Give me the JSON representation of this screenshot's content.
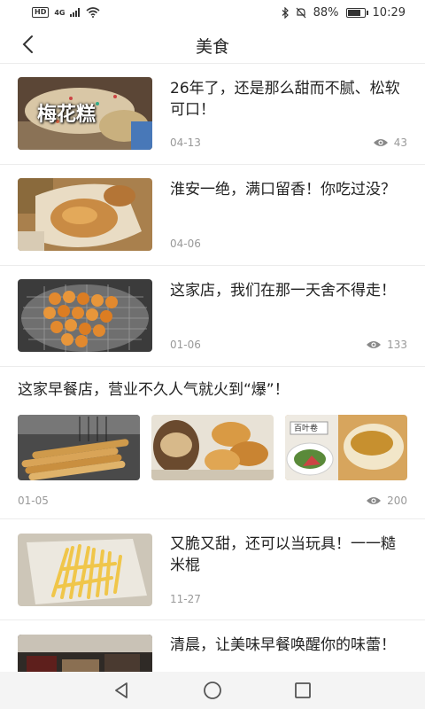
{
  "status": {
    "hd": "HD",
    "network": "4G",
    "battery": "88%",
    "battery_level": 0.88,
    "time": "10:29"
  },
  "header": {
    "title": "美食"
  },
  "articles": [
    {
      "title": "26年了，还是那么甜而不腻、松软可口！",
      "date": "04-13",
      "views": "43",
      "thumb_text": "梅花糕"
    },
    {
      "title": "淮安一绝，满口留香！你吃过没？",
      "date": "04-06"
    },
    {
      "title": "这家店，我们在那一天舍不得走！",
      "date": "01-06",
      "views": "133"
    },
    {
      "title": "这家早餐店，营业不久人气就火到“爆”！",
      "date": "01-05",
      "views": "200",
      "thumb3_text": "百叶卷"
    },
    {
      "title": "又脆又甜，还可以当玩具！一一糙米棍",
      "date": "11-27"
    },
    {
      "title": "清晨，让美味早餐唤醒你的味蕾！"
    }
  ],
  "icons": {
    "back": "chevron-left-icon",
    "views": "eye-icon",
    "nav_back": "triangle-back-icon",
    "nav_home": "circle-home-icon",
    "nav_recent": "square-recent-icon"
  },
  "colors": {
    "meta": "#999999",
    "divider": "#ececec",
    "nav_bg": "#f4f4f4"
  }
}
